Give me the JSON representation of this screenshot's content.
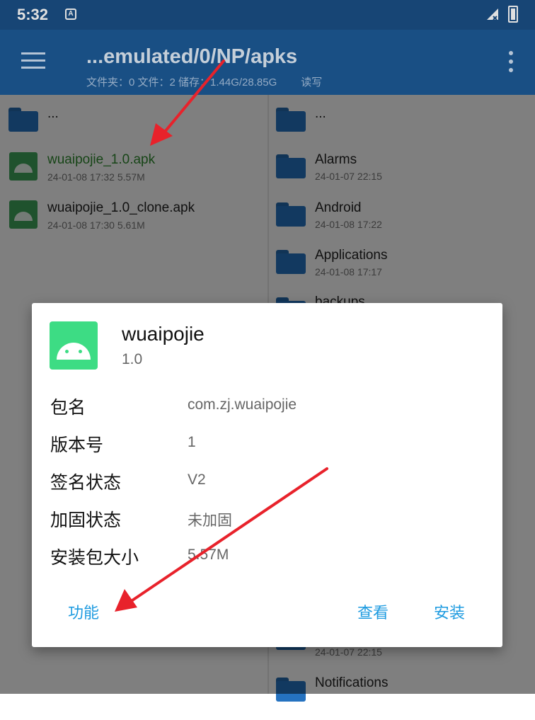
{
  "status": {
    "time": "5:32",
    "notif_icon": "A"
  },
  "toolbar": {
    "path": "...emulated/0/NP/apks",
    "stats": "文件夹：0  文件：2  储存：1.44G/28.85G",
    "mode": "读写"
  },
  "left_list": [
    {
      "icon": "folder-icon",
      "name": "...",
      "meta": ""
    },
    {
      "icon": "apk-icon",
      "name": "wuaipojie_1.0.apk",
      "meta": "24-01-08 17:32  5.57M",
      "highlight": true
    },
    {
      "icon": "apk-icon",
      "name": "wuaipojie_1.0_clone.apk",
      "meta": "24-01-08 17:30  5.61M"
    }
  ],
  "right_list": [
    {
      "name": "...",
      "meta": ""
    },
    {
      "name": "Alarms",
      "meta": "24-01-07 22:15"
    },
    {
      "name": "Android",
      "meta": "24-01-08 17:22"
    },
    {
      "name": "Applications",
      "meta": "24-01-08 17:17"
    },
    {
      "name": "backups",
      "meta": ""
    },
    {
      "name": "",
      "meta": "24-01-07 22:15"
    },
    {
      "name": "Notifications",
      "meta": ""
    }
  ],
  "dialog": {
    "app_name": "wuaipojie",
    "version": "1.0",
    "rows": [
      {
        "label": "包名",
        "value": "com.zj.wuaipojie"
      },
      {
        "label": "版本号",
        "value": "1"
      },
      {
        "label": "签名状态",
        "value": "V2"
      },
      {
        "label": "加固状态",
        "value": "未加固"
      },
      {
        "label": "安装包大小",
        "value": "5.57M"
      }
    ],
    "buttons": {
      "function": "功能",
      "view": "查看",
      "install": "安装"
    }
  },
  "colors": {
    "toolbar": "#1d5a97",
    "accent": "#1e9be0",
    "arrow": "#e8222b"
  }
}
